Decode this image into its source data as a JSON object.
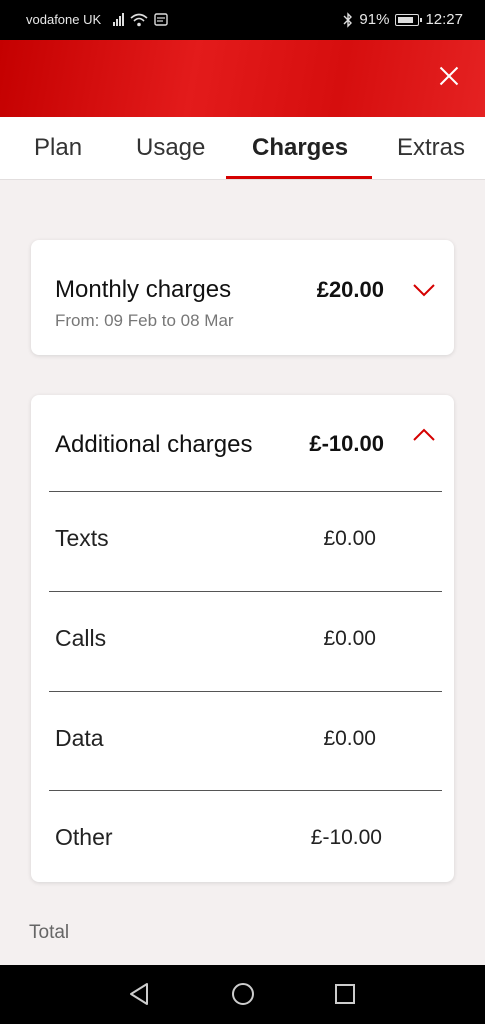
{
  "status_bar": {
    "carrier": "vodafone UK",
    "battery": "91%",
    "time": "12:27"
  },
  "header": {
    "close_icon": "close-icon",
    "color": "#e31b1b"
  },
  "tabs": [
    {
      "label": "Plan",
      "active": false
    },
    {
      "label": "Usage",
      "active": false
    },
    {
      "label": "Charges",
      "active": true
    },
    {
      "label": "Extras",
      "active": false
    }
  ],
  "monthly": {
    "title": "Monthly charges",
    "amount": "£20.00",
    "period": "From: 09 Feb to 08 Mar",
    "chevron": "chevron-down-icon"
  },
  "additional": {
    "title": "Additional charges",
    "amount": "£-10.00",
    "chevron": "chevron-up-icon",
    "rows": [
      {
        "label": "Texts",
        "value": "£0.00"
      },
      {
        "label": "Calls",
        "value": "£0.00"
      },
      {
        "label": "Data",
        "value": "£0.00"
      },
      {
        "label": "Other",
        "value": "£-10.00"
      }
    ]
  },
  "total_label": "Total",
  "accent_color": "#d50000"
}
